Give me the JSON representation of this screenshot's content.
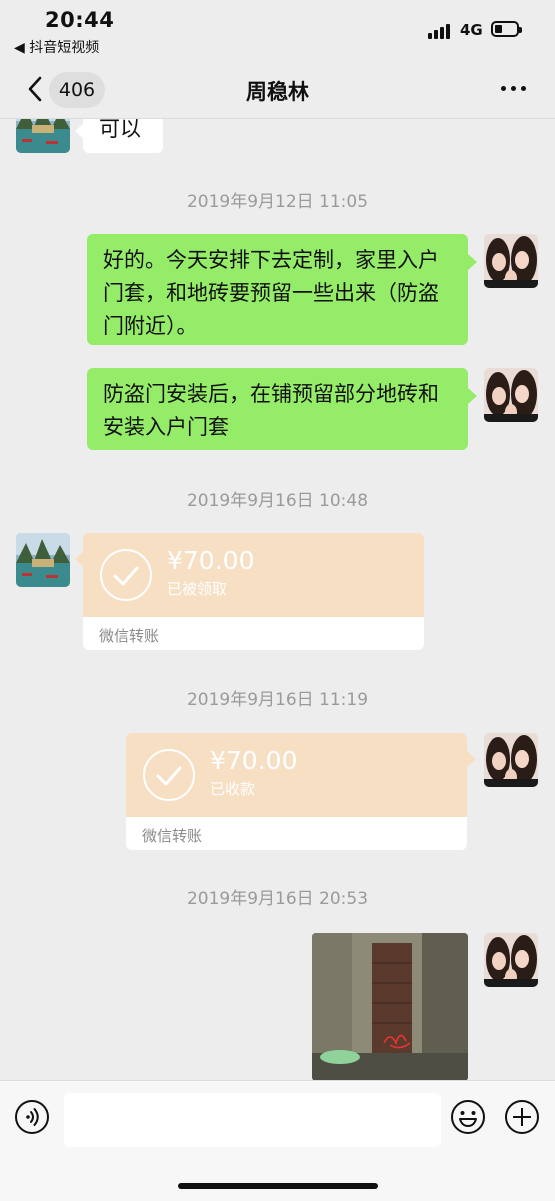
{
  "status_bar": {
    "time": "20:44",
    "back_app": "◀ 抖音短视频",
    "network": "4G"
  },
  "nav": {
    "unread_count": "406",
    "title": "周稳林"
  },
  "messages": {
    "m0_text": "可以",
    "ts1": "2019年9月12日 11:05",
    "m1_text": "好的。今天安排下去定制，家里入户门套，和地砖要预留一些出来（防盗门附近）。",
    "m2_text": "防盗门安装后，在铺预留部分地砖和安装入户门套",
    "ts2": "2019年9月16日 10:48",
    "t1_amount": "¥70.00",
    "t1_state": "已被领取",
    "t1_label": "微信转账",
    "ts3": "2019年9月16日 11:19",
    "t2_amount": "¥70.00",
    "t2_state": "已收款",
    "t2_label": "微信转账",
    "ts4": "2019年9月16日 20:53"
  },
  "colors": {
    "self_bubble": "#95ec69",
    "other_bubble": "#ffffff",
    "transfer_bubble": "#f7dfc4",
    "background": "#ededed"
  },
  "icons": {
    "back": "chevron-left-icon",
    "more": "more-dots-icon",
    "voice": "voice-icon",
    "emoji": "emoji-icon",
    "plus": "plus-icon",
    "check": "check-icon"
  }
}
